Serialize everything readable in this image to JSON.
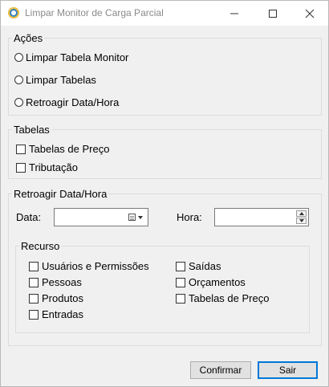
{
  "window": {
    "title": "Limpar Monitor de Carga Parcial"
  },
  "acoes": {
    "legend": "Ações",
    "options": [
      "Limpar Tabela Monitor",
      "Limpar Tabelas",
      "Retroagir Data/Hora"
    ]
  },
  "tabelas": {
    "legend": "Tabelas",
    "items": [
      "Tabelas de Preço",
      "Tributação"
    ]
  },
  "retroagir": {
    "legend": "Retroagir Data/Hora",
    "data_label": "Data:",
    "data_value": "",
    "hora_label": "Hora:",
    "hora_value": ""
  },
  "recurso": {
    "legend": "Recurso",
    "left_items": [
      "Usuários e Permissões",
      "Pessoas",
      "Produtos",
      "Entradas"
    ],
    "right_items": [
      "Saídas",
      "Orçamentos",
      "Tabelas de Preço"
    ]
  },
  "footer": {
    "confirm_label": "Confirmar",
    "exit_label": "Sair"
  }
}
